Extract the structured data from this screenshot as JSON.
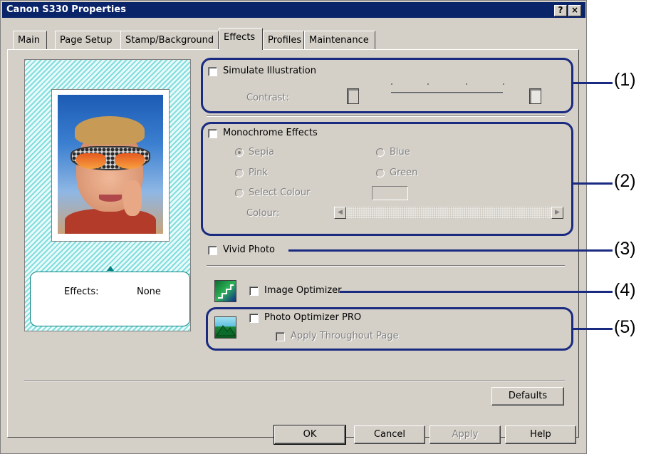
{
  "window": {
    "title": "Canon S330 Properties",
    "help_btn": "?",
    "close_btn": "×"
  },
  "tabs": [
    {
      "label": "Main"
    },
    {
      "label": "Page Setup"
    },
    {
      "label": "Stamp/Background"
    },
    {
      "label": "Effects",
      "active": true
    },
    {
      "label": "Profiles"
    },
    {
      "label": "Maintenance"
    }
  ],
  "preview": {
    "effects_label": "Effects:",
    "effects_value": "None"
  },
  "simulate": {
    "label": "Simulate Illustration",
    "checked": false,
    "contrast_label": "Contrast:"
  },
  "monochrome": {
    "label": "Monochrome Effects",
    "checked": false,
    "options": {
      "sepia": "Sepia",
      "blue": "Blue",
      "pink": "Pink",
      "green": "Green",
      "select_colour": "Select Colour"
    },
    "selected": "Sepia",
    "colour_label": "Colour:"
  },
  "vivid_photo": {
    "label": "Vivid Photo",
    "checked": false
  },
  "image_optimizer": {
    "label": "Image Optimizer",
    "checked": false
  },
  "photo_optimizer": {
    "label": "Photo Optimizer PRO",
    "checked": false,
    "apply_label": "Apply Throughout Page"
  },
  "buttons": {
    "defaults": "Defaults",
    "ok": "OK",
    "cancel": "Cancel",
    "apply": "Apply",
    "help": "Help"
  },
  "callouts": [
    "(1)",
    "(2)",
    "(3)",
    "(4)",
    "(5)"
  ],
  "colors": {
    "annotation": "#1a2a80",
    "titlebar": "#0a246a",
    "face": "#d4d0c8",
    "preview_teal": "#7fdede"
  },
  "icons": {
    "simulate_low": "contrast-low-icon",
    "simulate_high": "contrast-high-icon",
    "image_optimizer": "image-optimizer-icon",
    "photo_optimizer": "photo-optimizer-icon"
  }
}
